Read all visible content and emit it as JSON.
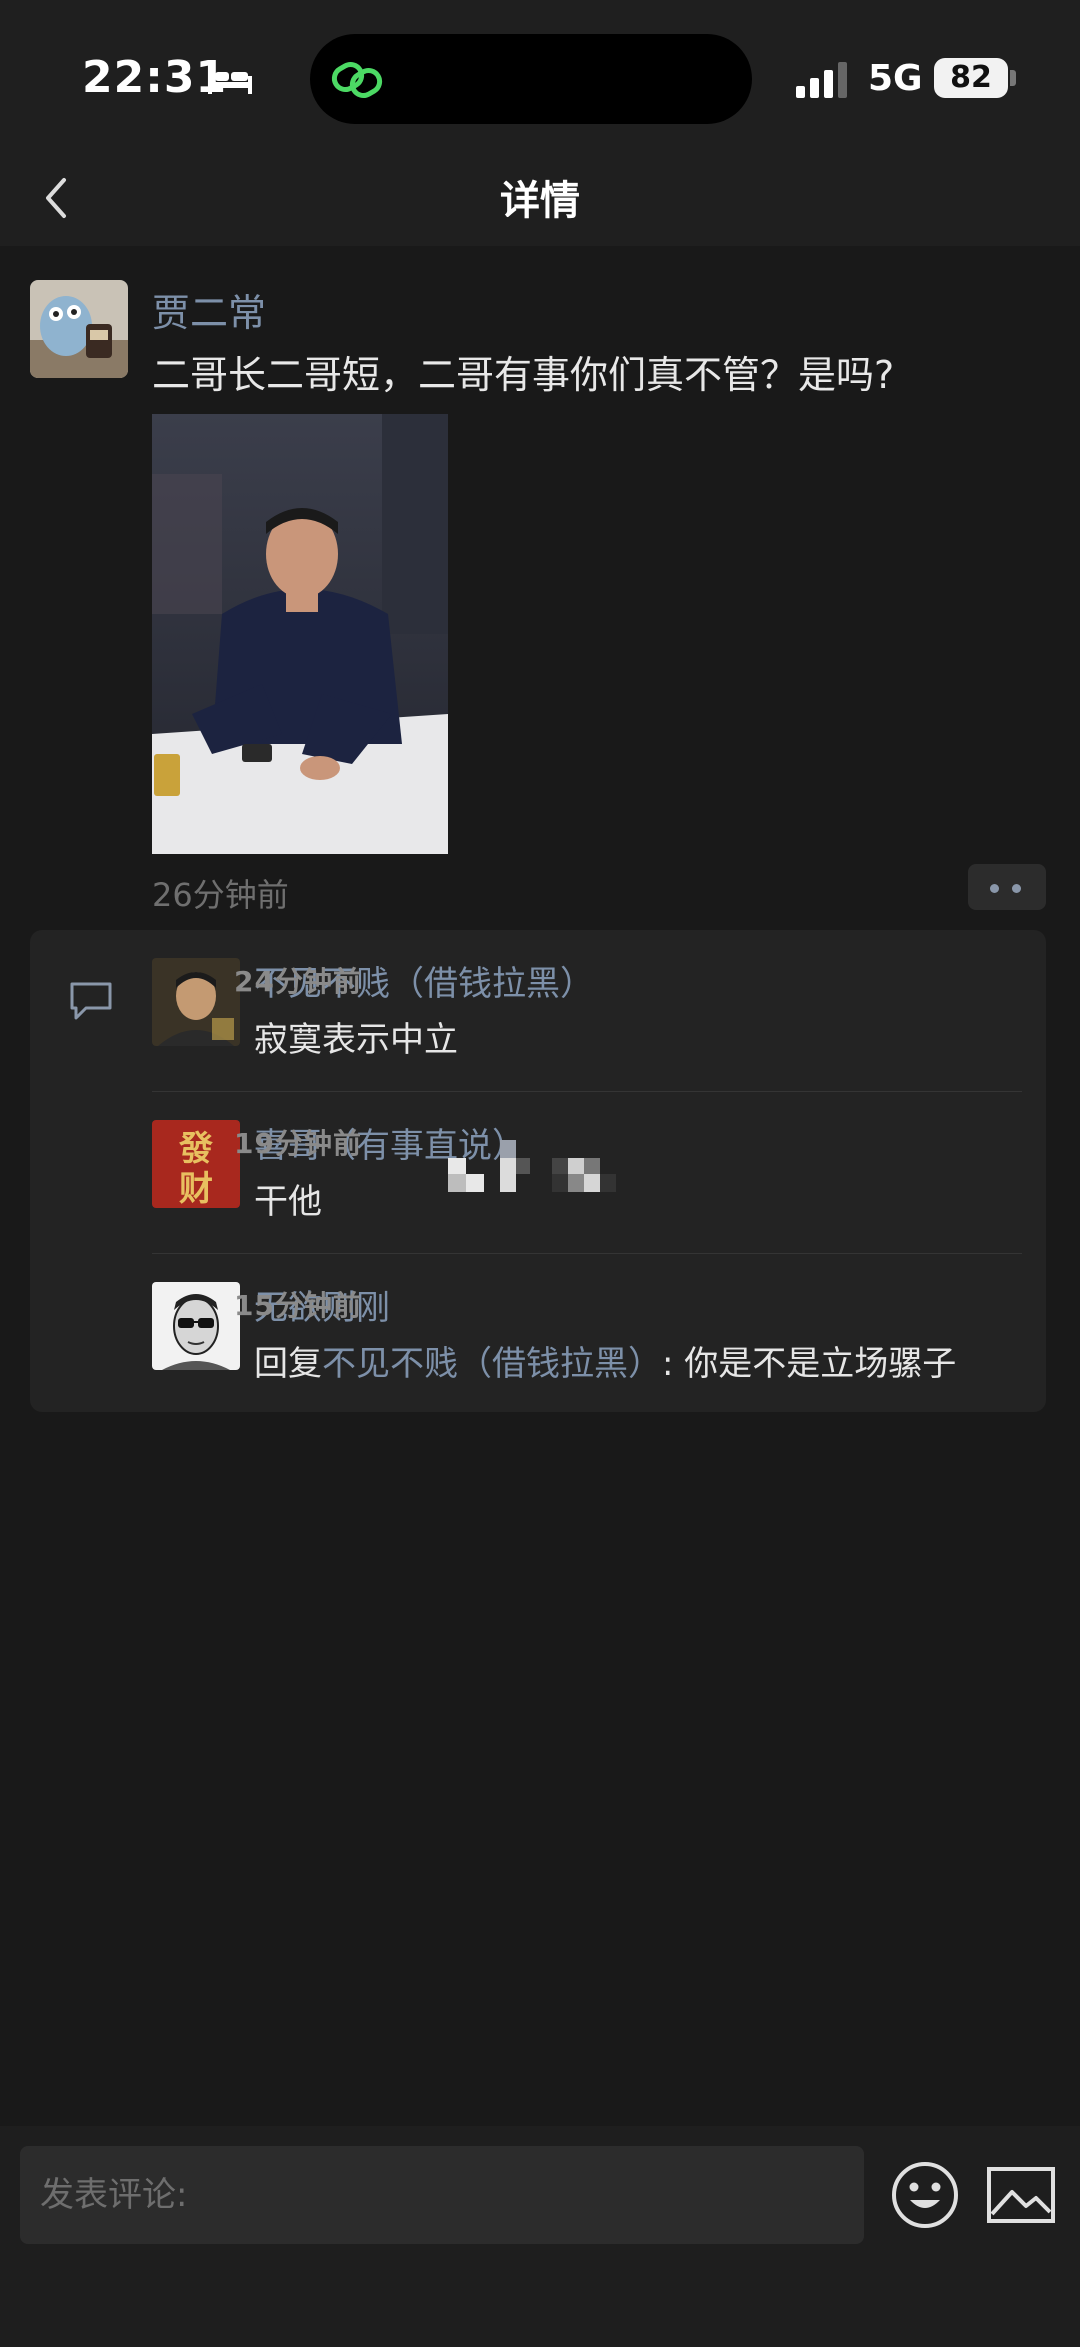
{
  "status_bar": {
    "time": "22:31",
    "network": "5G",
    "battery": "82"
  },
  "nav": {
    "title": "详情"
  },
  "post": {
    "author": "贾二常",
    "text": "二哥长二哥短，二哥有事你们真不管？是吗?",
    "time": "26分钟前"
  },
  "comments": [
    {
      "name": "不见不贱（借钱拉黑）",
      "time": "24分钟前",
      "text": "寂寞表示中立"
    },
    {
      "name": "喜哥（有事直说）",
      "time": "19分钟前",
      "text": "干他",
      "avatar_text": "發财"
    },
    {
      "name": "无欲则刚",
      "time": "15分钟前",
      "reply_prefix": "回复",
      "reply_target": "不见不贱（借钱拉黑）",
      "text": ": 你是不是立场骡子"
    }
  ],
  "bottom_bar": {
    "input_placeholder": "发表评论:"
  },
  "colors": {
    "background": "#191919",
    "bar": "#1f1f1f",
    "link": "#7d90a9",
    "card": "#232323"
  },
  "icons": [
    "bed-icon",
    "link-icon",
    "signal-icon",
    "back-icon",
    "comment-icon",
    "emoji-icon",
    "image-icon",
    "more-icon"
  ]
}
